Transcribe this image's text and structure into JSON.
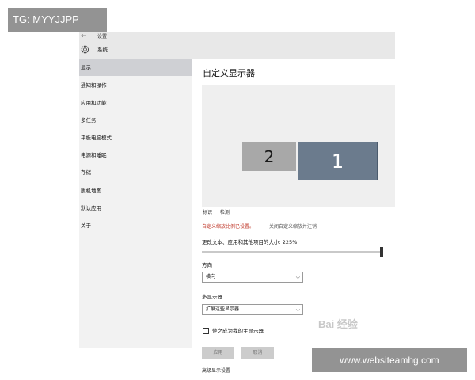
{
  "titlebar": {
    "back_glyph": "←",
    "app_title": "设置",
    "section_title": "系统"
  },
  "sidebar": {
    "items": [
      {
        "label": "显示",
        "active": true
      },
      {
        "label": "通知和操作"
      },
      {
        "label": "应用和功能"
      },
      {
        "label": "多任务"
      },
      {
        "label": "平板电脑模式"
      },
      {
        "label": "电源和睡眠"
      },
      {
        "label": "存储"
      },
      {
        "label": "脱机地图"
      },
      {
        "label": "默认应用"
      },
      {
        "label": "关于"
      }
    ]
  },
  "main": {
    "heading": "自定义显示器",
    "monitors": [
      {
        "id": "2",
        "color": "#a8a8a8"
      },
      {
        "id": "1",
        "color": "#6b7b8d",
        "selected": true
      }
    ],
    "identify_link": "标识",
    "detect_link": "检测",
    "warning_text": "自定义缩放比例已设置。",
    "turn_off_link": "关闭自定义缩放并注销",
    "size_label": "更改文本、应用和其他项目的大小: 225%",
    "slider_value_percent": 225,
    "orientation_label": "方向",
    "orientation_value": "横向",
    "multi_display_label": "多显示器",
    "multi_display_value": "扩展这些显示器",
    "primary_checkbox_label": "使之成为我的主显示器",
    "primary_checked": false,
    "apply_button": "应用",
    "cancel_button": "取消",
    "advanced_link": "高级显示设置"
  },
  "overlays": {
    "tg_text": "TG: MYYJJPP",
    "site_text": "www.websiteamhg.com",
    "baidu_text": "Bai 经验"
  },
  "colors": {
    "warning": "#c0392b",
    "active_nav": "#cfd0d4",
    "monitor_primary": "#6b7b8d"
  }
}
